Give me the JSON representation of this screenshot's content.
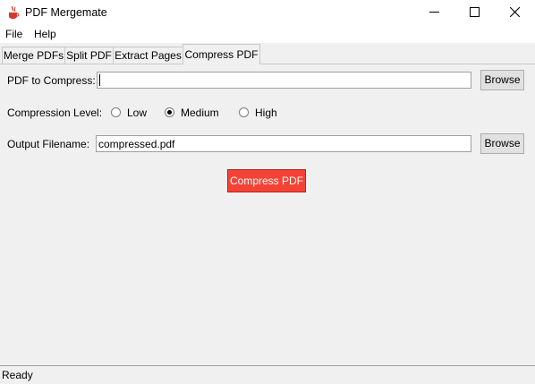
{
  "window": {
    "title": "PDF Mergemate"
  },
  "menu": {
    "items": [
      "File",
      "Help"
    ]
  },
  "tabs": [
    {
      "label": "Merge PDFs",
      "active": false
    },
    {
      "label": "Split PDF",
      "active": false
    },
    {
      "label": "Extract Pages",
      "active": false
    },
    {
      "label": "Compress PDF",
      "active": true
    }
  ],
  "compress": {
    "input_label": "PDF to Compress:",
    "input_value": "",
    "browse_label": "Browse",
    "level_label": "Compression Level:",
    "levels": [
      {
        "label": "Low",
        "selected": false
      },
      {
        "label": "Medium",
        "selected": true
      },
      {
        "label": "High",
        "selected": false
      }
    ],
    "output_label": "Output Filename:",
    "output_value": "compressed.pdf",
    "output_browse_label": "Browse",
    "action_label": "Compress PDF"
  },
  "status": {
    "text": "Ready"
  },
  "colors": {
    "accent_button": "#f44336",
    "app_icon": "#d33a2c"
  },
  "icons": {
    "app": "java-cup-icon",
    "minimize": "minimize-icon",
    "maximize": "maximize-icon",
    "close": "close-icon"
  }
}
